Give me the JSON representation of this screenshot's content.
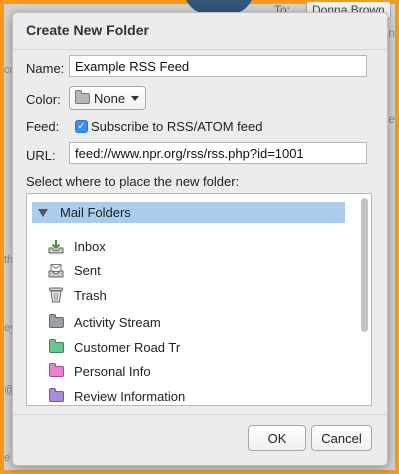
{
  "background": {
    "to_label": "To:",
    "recipient": "Donna Brown"
  },
  "dialog": {
    "title": "Create New Folder",
    "name_label": "Name:",
    "name_value": "Example RSS Feed",
    "color_label": "Color:",
    "color_value": "None",
    "feed_label": "Feed:",
    "feed_checkbox_label": "Subscribe to RSS/ATOM feed",
    "feed_checked": true,
    "url_label": "URL:",
    "url_value": "feed://www.npr.org/rss/rss.php?id=1001",
    "place_label": "Select where to place the new folder:",
    "tree_root": "Mail Folders",
    "folders": [
      {
        "label": "Inbox",
        "icon": "inbox-tray-icon"
      },
      {
        "label": "Sent",
        "icon": "sent-tray-icon"
      },
      {
        "label": "Trash",
        "icon": "trash-can-icon"
      },
      {
        "label": "Activity Stream",
        "icon": "folder-icon",
        "color": "#9aa0a6"
      },
      {
        "label": "Customer Road Tr",
        "icon": "folder-icon",
        "color": "#67c58f"
      },
      {
        "label": "Personal Info",
        "icon": "folder-icon",
        "color": "#ec7fcf"
      },
      {
        "label": "Review Information",
        "icon": "folder-icon",
        "color": "#a98be0"
      }
    ],
    "ok_label": "OK",
    "cancel_label": "Cancel"
  },
  "colors": {
    "frame": "#f39b1f",
    "selection": "#a9cdeb",
    "checkbox": "#3b8ef0"
  }
}
